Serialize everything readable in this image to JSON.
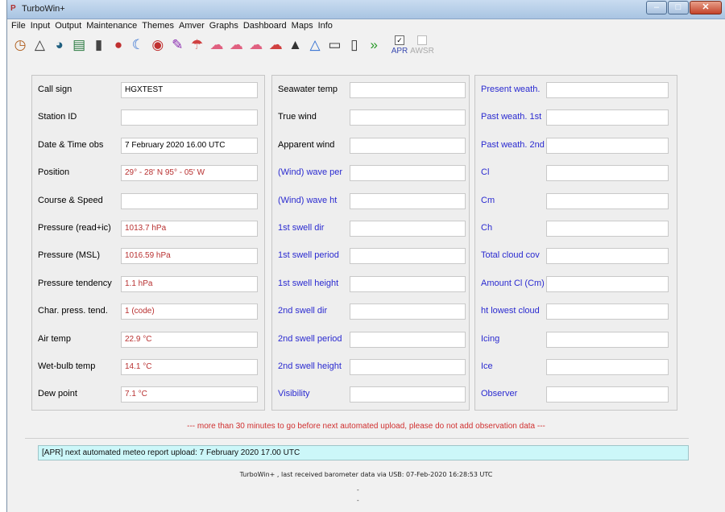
{
  "window": {
    "title": "TurboWin+"
  },
  "menu": [
    "File",
    "Input",
    "Output",
    "Maintenance",
    "Themes",
    "Amver",
    "Graphs",
    "Dashboard",
    "Maps",
    "Info"
  ],
  "toolbar": {
    "icons": [
      "clock-icon",
      "compass-icon",
      "barometer-icon",
      "chart-icon",
      "thermometer-icon",
      "seawater-temp-icon",
      "moon-icon",
      "binoculars-icon",
      "pen-icon",
      "umbrella-icon",
      "cloud-low-icon",
      "cloud-middle-icon",
      "cloud-high-icon",
      "cloud-cover-icon",
      "ship-icon",
      "wave-icon",
      "document-icon",
      "phone-icon",
      "forward-icon"
    ],
    "apr": {
      "label": "APR",
      "checked": true
    },
    "awsr": {
      "label": "AWSR",
      "checked": false
    }
  },
  "panels": [
    {
      "rows": [
        {
          "label": "Call sign",
          "label_color": "black",
          "value": "HGXTEST",
          "value_color": "black"
        },
        {
          "label": "Station ID",
          "label_color": "black",
          "value": "",
          "value_color": "black"
        },
        {
          "label": "Date & Time obs",
          "label_color": "black",
          "value": "7 February 2020  16.00 UTC",
          "value_color": "black"
        },
        {
          "label": "Position",
          "label_color": "black",
          "value": "29° - 28' N  95° - 05' W",
          "value_color": "red"
        },
        {
          "label": "Course & Speed",
          "label_color": "black",
          "value": "",
          "value_color": "black"
        },
        {
          "label": "Pressure (read+ic)",
          "label_color": "black",
          "value": "1013.7 hPa",
          "value_color": "red"
        },
        {
          "label": "Pressure (MSL)",
          "label_color": "black",
          "value": "1016.59 hPa",
          "value_color": "red"
        },
        {
          "label": "Pressure tendency",
          "label_color": "black",
          "value": "1.1 hPa",
          "value_color": "red"
        },
        {
          "label": "Char. press. tend.",
          "label_color": "black",
          "value": "1 (code)",
          "value_color": "red"
        },
        {
          "label": "Air temp",
          "label_color": "black",
          "value": "22.9 °C",
          "value_color": "red"
        },
        {
          "label": "Wet-bulb temp",
          "label_color": "black",
          "value": "14.1 °C",
          "value_color": "red"
        },
        {
          "label": "Dew point",
          "label_color": "black",
          "value": "7.1 °C",
          "value_color": "red"
        }
      ]
    },
    {
      "rows": [
        {
          "label": "Seawater temp",
          "label_color": "black",
          "value": "",
          "value_color": "black"
        },
        {
          "label": "True wind",
          "label_color": "black",
          "value": "",
          "value_color": "black"
        },
        {
          "label": "Apparent wind",
          "label_color": "black",
          "value": "",
          "value_color": "black"
        },
        {
          "label": "(Wind) wave per",
          "label_color": "blue",
          "value": "",
          "value_color": "black"
        },
        {
          "label": "(Wind) wave ht",
          "label_color": "blue",
          "value": "",
          "value_color": "black"
        },
        {
          "label": "1st swell dir",
          "label_color": "blue",
          "value": "",
          "value_color": "black"
        },
        {
          "label": "1st swell period",
          "label_color": "blue",
          "value": "",
          "value_color": "black"
        },
        {
          "label": "1st swell height",
          "label_color": "blue",
          "value": "",
          "value_color": "black"
        },
        {
          "label": "2nd swell dir",
          "label_color": "blue",
          "value": "",
          "value_color": "black"
        },
        {
          "label": "2nd swell period",
          "label_color": "blue",
          "value": "",
          "value_color": "black"
        },
        {
          "label": "2nd swell height",
          "label_color": "blue",
          "value": "",
          "value_color": "black"
        },
        {
          "label": "Visibility",
          "label_color": "blue",
          "value": "",
          "value_color": "black"
        }
      ]
    },
    {
      "rows": [
        {
          "label": "Present weath.",
          "label_color": "blue",
          "value": "",
          "value_color": "black"
        },
        {
          "label": "Past weath. 1st",
          "label_color": "blue",
          "value": "",
          "value_color": "black"
        },
        {
          "label": "Past weath. 2nd",
          "label_color": "blue",
          "value": "",
          "value_color": "black"
        },
        {
          "label": "Cl",
          "label_color": "blue",
          "value": "",
          "value_color": "black"
        },
        {
          "label": "Cm",
          "label_color": "blue",
          "value": "",
          "value_color": "black"
        },
        {
          "label": "Ch",
          "label_color": "blue",
          "value": "",
          "value_color": "black"
        },
        {
          "label": "Total cloud cov",
          "label_color": "blue",
          "value": "",
          "value_color": "black"
        },
        {
          "label": "Amount Cl (Cm)",
          "label_color": "blue",
          "value": "",
          "value_color": "black"
        },
        {
          "label": "ht lowest cloud",
          "label_color": "blue",
          "value": "",
          "value_color": "black"
        },
        {
          "label": "Icing",
          "label_color": "blue",
          "value": "",
          "value_color": "black"
        },
        {
          "label": "Ice",
          "label_color": "blue",
          "value": "",
          "value_color": "black"
        },
        {
          "label": "Observer",
          "label_color": "blue",
          "value": "",
          "value_color": "black"
        }
      ]
    }
  ],
  "warning": "--- more than 30 minutes to go before next automated upload, please do not add observation data ---",
  "status": "[APR] next automated meteo report upload: 7 February 2020 17.00 UTC",
  "footer": "TurboWin+ , last received barometer data via USB: 07-Feb-2020 16:28:53 UTC",
  "footer_marks": [
    "-",
    "-"
  ],
  "colors": {
    "label_blue": "#2a2ad0",
    "value_red": "#b83030",
    "status_bg": "#ccf7f9",
    "warning": "#d03030"
  }
}
